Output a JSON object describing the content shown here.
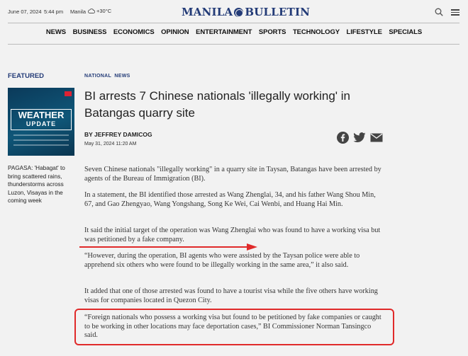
{
  "topbar": {
    "date": "June 07, 2024",
    "time": "5:44 pm",
    "city": "Manila",
    "temperature": "+30°C",
    "logo": "MANILA BULLETIN",
    "logo_left": "MANILA",
    "logo_right": "BULLETIN",
    "icons": [
      "cloud-icon",
      "search-icon",
      "menu-icon"
    ]
  },
  "nav": {
    "items": [
      "NEWS",
      "BUSINESS",
      "ECONOMICS",
      "OPINION",
      "ENTERTAINMENT",
      "SPORTS",
      "TECHNOLOGY",
      "LIFESTYLE",
      "SPECIALS"
    ]
  },
  "sidebar": {
    "heading": "FEATURED",
    "promo_title": "WEATHER",
    "promo_subtitle": "UPDATE",
    "caption": "PAGASA: 'Habagat' to bring scattered rains, thunderstorms across Luzon, Visayas in the coming week"
  },
  "article": {
    "section": "NATIONAL  NEWS",
    "headline": "BI arrests 7 Chinese nationals 'illegally working' in Batangas quarry site",
    "byline": "BY JEFFREY DAMICOG",
    "date": "May 31, 2024 11:20 AM",
    "share_icons": [
      "facebook-icon",
      "twitter-icon",
      "email-icon"
    ],
    "paragraphs": [
      "Seven Chinese nationals \"illegally working\" in a quarry site in Taysan, Batangas have been arrested by agents of the Bureau of Immigration (BI).",
      "In a statement, the BI identified those arrested as Wang Zhenglai, 34, and his father Wang Shou Min, 67, and Gao Zhengyao, Wang Yongshang, Song Ke Wei, Cai Wenbi, and Huang Hai Min.",
      "It said the initial target of the operation was Wang Zhenglai who was found to have a working visa but was petitioned by a fake company.",
      "“However, during the operation, BI agents who were assisted by the Taysan police were able to apprehend six others who were found to be illegally working in the same area,” it also said.",
      "It added that one of those arrested was found to have a tourist visa while the five others have working visas for companies located in Quezon City.",
      "“Foreign nationals who possess a working visa but found to be petitioned by fake companies or caught to be working in other locations may face deportation cases,” BI Commissioner Norman Tansingco said."
    ]
  },
  "annotations": {
    "arrow_color": "#e02a2a",
    "box_color": "#e02a2a"
  }
}
